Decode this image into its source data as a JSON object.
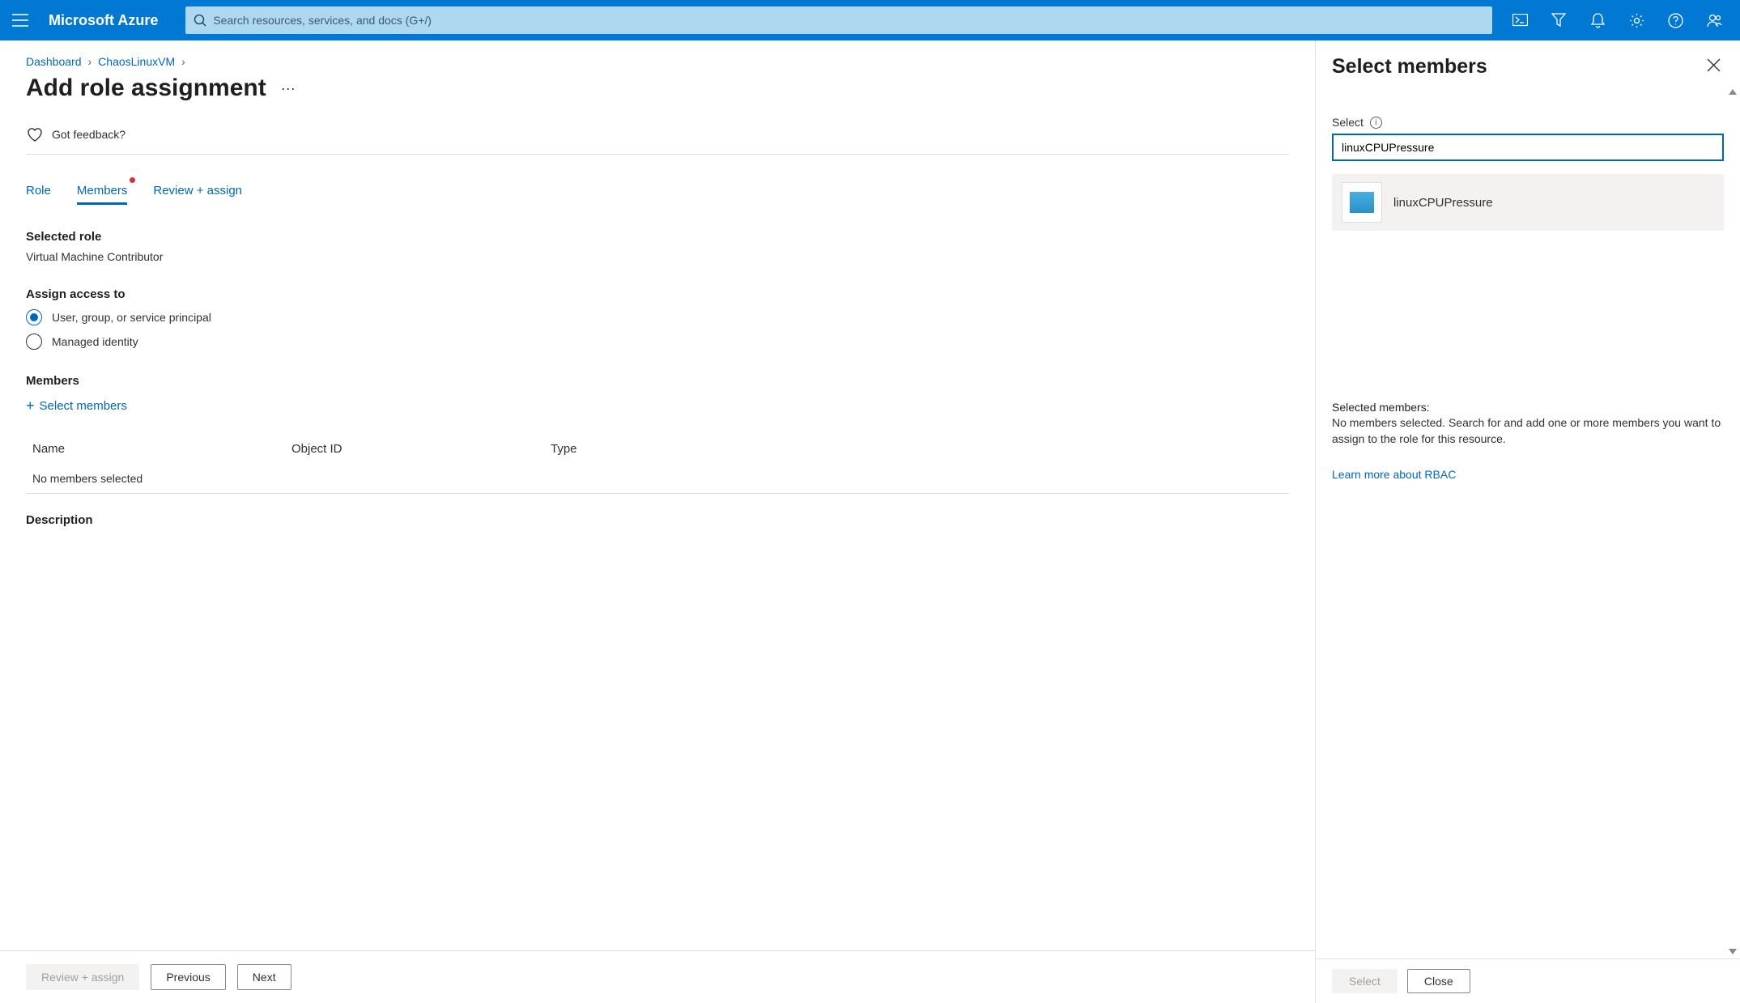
{
  "topbar": {
    "brand": "Microsoft Azure",
    "search_placeholder": "Search resources, services, and docs (G+/)"
  },
  "breadcrumb": {
    "items": [
      "Dashboard",
      "ChaosLinuxVM"
    ]
  },
  "page": {
    "title": "Add role assignment",
    "feedback": "Got feedback?"
  },
  "tabs": {
    "role": "Role",
    "members": "Members",
    "review": "Review + assign"
  },
  "selected_role": {
    "label": "Selected role",
    "value": "Virtual Machine Contributor"
  },
  "assign_access": {
    "label": "Assign access to",
    "option_user": "User, group, or service principal",
    "option_identity": "Managed identity"
  },
  "members": {
    "label": "Members",
    "select_link": "Select members",
    "col_name": "Name",
    "col_object": "Object ID",
    "col_type": "Type",
    "empty": "No members selected"
  },
  "description": {
    "label": "Description"
  },
  "footer": {
    "review": "Review + assign",
    "previous": "Previous",
    "next": "Next"
  },
  "panel": {
    "title": "Select members",
    "field_label": "Select",
    "input_value": "linuxCPUPressure",
    "result_name": "linuxCPUPressure",
    "selected_label": "Selected members:",
    "selected_msg": "No members selected. Search for and add one or more members you want to assign to the role for this resource.",
    "rbac_link": "Learn more about RBAC",
    "select_btn": "Select",
    "close_btn": "Close"
  }
}
